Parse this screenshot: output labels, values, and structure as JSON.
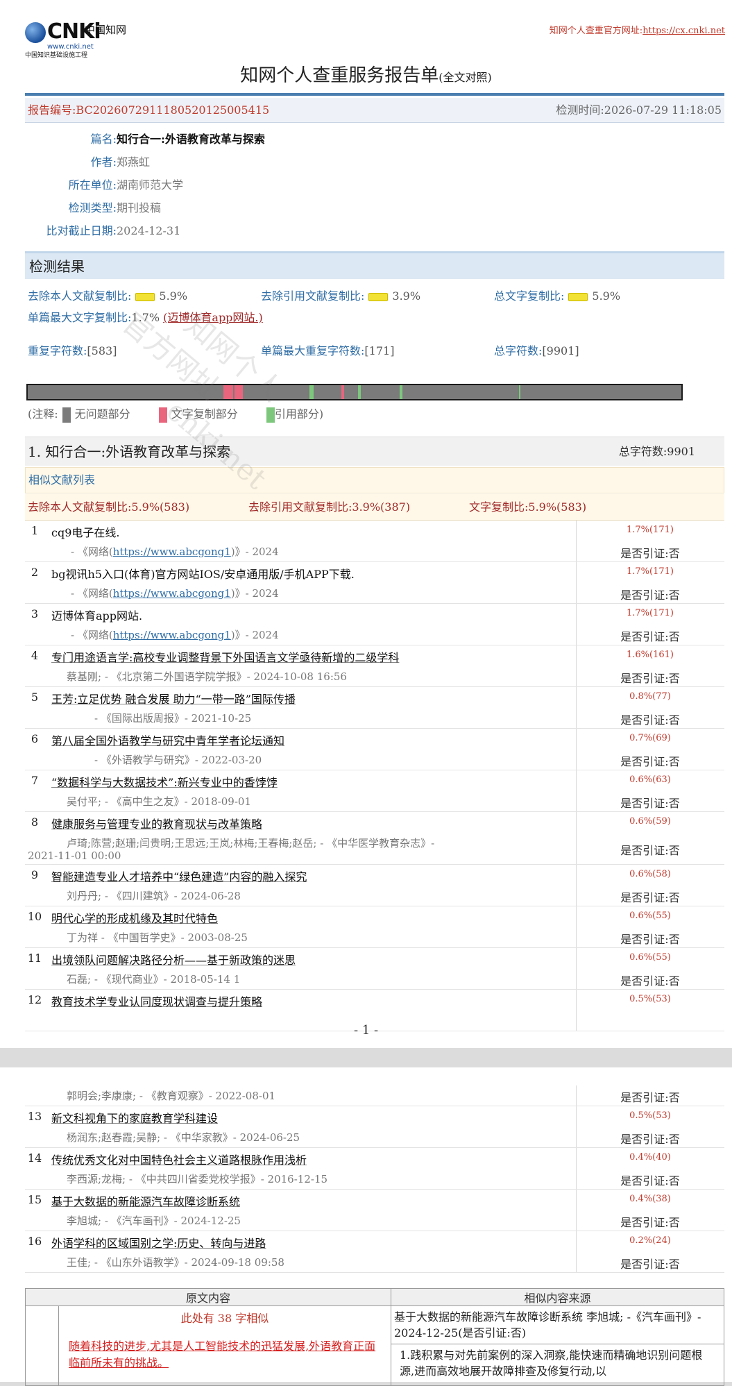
{
  "logo": {
    "brand": "CNKi",
    "brand_cn": "中国知网",
    "url": "www.cnki.net",
    "subtitle": "中国知识基础设施工程"
  },
  "header": {
    "official_label": "知网个人查重官方网址:",
    "official_url": "https://cx.cnki.net",
    "title": "知网个人查重服务报告单",
    "title_suffix": "(全文对照)"
  },
  "report": {
    "id_text": "报告编号:BC20260729111805201250054​15",
    "time_text": "检测时间:2026-07-29 11:18:05"
  },
  "info": [
    {
      "key": "篇名:",
      "value": "知行合一:外语教育改革与探索",
      "bold": true
    },
    {
      "key": "作者:",
      "value": "郑燕虹",
      "bold": false
    },
    {
      "key": "所在单位:",
      "value": "湖南师范大学",
      "bold": false
    },
    {
      "key": "检测类型:",
      "value": "期刊投稿",
      "bold": false
    },
    {
      "key": "比对截止日期:",
      "value": "2024-12-31",
      "bold": false
    }
  ],
  "result": {
    "section_title": "检测结果",
    "self_label": "去除本人文献复制比:",
    "self_value": "5.9%",
    "cite_label": "去除引用文献复制比:",
    "cite_value": "3.9%",
    "total_label": "总文字复制比:",
    "total_value": "5.9%",
    "single_label": "单篇最大文字复制比:",
    "single_value": "1.7%",
    "single_source": "(迈博体育app网站.)",
    "repeat_label": "重复字符数:",
    "repeat_value": "[583]",
    "single_repeat_label": "单篇最大重复字符数:",
    "single_repeat_value": "[171]",
    "total_chars_label": "总字符数:",
    "total_chars_value": "[9901]"
  },
  "legend": {
    "prefix": "(注释:",
    "none": "无问题部分",
    "copy": "文字复制部分",
    "cite": "引用部分)"
  },
  "doc": {
    "title": "1. 知行合一:外语教育改革与探索",
    "total": "总字符数:9901",
    "similar_title": "相似文献列表",
    "sum_self": "去除本人文献复制比:5.9%(583)",
    "sum_cite": "去除引用文献复制比:3.9%(387)",
    "sum_total": "文字复制比:5.9%(583)"
  },
  "items": [
    {
      "n": "1",
      "title": "cq9电子在线.",
      "meta": "- 《网络(",
      "link": "https://www.abcgong1",
      "meta2": ")》- 2024",
      "pct": "1.7%(171)",
      "cite": "是否引证:否"
    },
    {
      "n": "2",
      "title": "bg视讯h5入口(体育)官方网站IOS/安卓通用版/手机APP下载.",
      "meta": "- 《网络(",
      "link": "https://www.abcgong1",
      "meta2": ")》- 2024",
      "pct": "1.7%(171)",
      "cite": "是否引证:否"
    },
    {
      "n": "3",
      "title": "迈博体育app网站.",
      "meta": "- 《网络(",
      "link": "https://www.abcgong1",
      "meta2": ")》- 2024",
      "pct": "1.7%(171)",
      "cite": "是否引证:否"
    },
    {
      "n": "4",
      "title": "专门用途语言学:高校专业调整背景下外国语言文学亟待新增的二级学科",
      "meta": "蔡基刚; - 《北京第二外国语学院学报》- 2024-10-08 16:56",
      "pct": "1.6%(161)",
      "cite": "是否引证:否"
    },
    {
      "n": "5",
      "title": "王芳:立足优势 融合发展 助力“一带一路”国际传播",
      "meta": "- 《国际出版周报》- 2021-10-25",
      "pct": "0.8%(77)",
      "cite": "是否引证:否"
    },
    {
      "n": "6",
      "title": "第八届全国外语教学与研究中青年学者论坛通知",
      "meta": "- 《外语教学与研究》- 2022-03-20",
      "pct": "0.7%(69)",
      "cite": "是否引证:否"
    },
    {
      "n": "7",
      "title": "“数据科学与大数据技术”:新兴专业中的香饽饽",
      "meta": "吴付平; - 《高中生之友》- 2018-09-01",
      "pct": "0.6%(63)",
      "cite": "是否引证:否"
    },
    {
      "n": "8",
      "title": "健康服务与管理专业的教育现状与改革策略",
      "meta": "卢琦;陈营;赵珊;闫贵明;王思远;王岚;林梅;王春梅;赵岳; - 《中华医学教育杂志》-",
      "meta_b": "2021-11-01 00:00",
      "pct": "0.6%(59)",
      "cite": "是否引证:否"
    },
    {
      "n": "9",
      "title": "智能建造专业人才培养中“绿色建造”内容的融入探究",
      "meta": "刘丹丹; - 《四川建筑》- 2024-06-28",
      "pct": "0.6%(58)",
      "cite": "是否引证:否"
    },
    {
      "n": "10",
      "title": "明代心学的形成机缘及其时代特色",
      "meta": "丁为祥 - 《中国哲学史》- 2003-08-25",
      "pct": "0.6%(55)",
      "cite": "是否引证:否"
    },
    {
      "n": "11",
      "title": "出境领队问题解决路径分析——基于新政策的迷思",
      "meta": "石磊; - 《现代商业》- 2018-05-14 1",
      "pct": "0.6%(55)",
      "cite": "是否引证:否"
    },
    {
      "n": "12",
      "title": "教育技术学专业认同度现状调查与提升策略",
      "meta": "",
      "pct": "0.5%(53)",
      "cite": ""
    }
  ],
  "page_number": "- 1 -",
  "items2": [
    {
      "n": "",
      "title": "",
      "meta": "郭明会;李康康; - 《教育观察》- 2022-08-01",
      "pct": "",
      "cite": "是否引证:否"
    },
    {
      "n": "13",
      "title": "新文科视角下的家庭教育学科建设",
      "meta": "杨润东;赵春霞;吴静; - 《中华家教》- 2024-06-25",
      "pct": "0.5%(53)",
      "cite": "是否引证:否"
    },
    {
      "n": "14",
      "title": "传统优秀文化对中国特色社会主义道路根脉作用浅析",
      "meta": "李西源;龙梅; - 《中共四川省委党校学报》- 2016-12-15",
      "pct": "0.4%(40)",
      "cite": "是否引证:否"
    },
    {
      "n": "15",
      "title": "基于大数据的新能源汽车故障诊断系统",
      "meta": "李旭城; - 《汽车画刊》- 2024-12-25",
      "pct": "0.4%(38)",
      "cite": "是否引证:否"
    },
    {
      "n": "16",
      "title": "外语学科的区域国别之学:历史、转向与进路",
      "meta": "王佳; - 《山东外语教学》- 2024-09-18 09:58",
      "pct": "0.2%(24)",
      "cite": "是否引证:否"
    }
  ],
  "compare": {
    "head_left": "原文内容",
    "head_right": "相似内容来源",
    "note": "此处有 38 字相似",
    "original": "随着科技的进步,尤其是人工智能技术的迅猛发展,外语教育正面临前所未有的挑战。",
    "source_head": "基于大数据的新能源汽车故障诊断系统 李旭城; -《汽车画刊》- 2024-12-25(是否引证:否)",
    "source_text": "1.践积累与对先前案例的深入洞察,能快速而精确地识别问题根源,进而高效地展开故障排查及修复行动,以"
  },
  "watermark": {
    "line1": "知网个人",
    "line2": "官方网址",
    "line3": "cnki.net"
  },
  "colors": {
    "accent": "#2e6ca4",
    "red": "#c0392b",
    "bar_gray": "#7b7b7b",
    "copy": "#e9657d",
    "cite": "#7dc77d"
  }
}
